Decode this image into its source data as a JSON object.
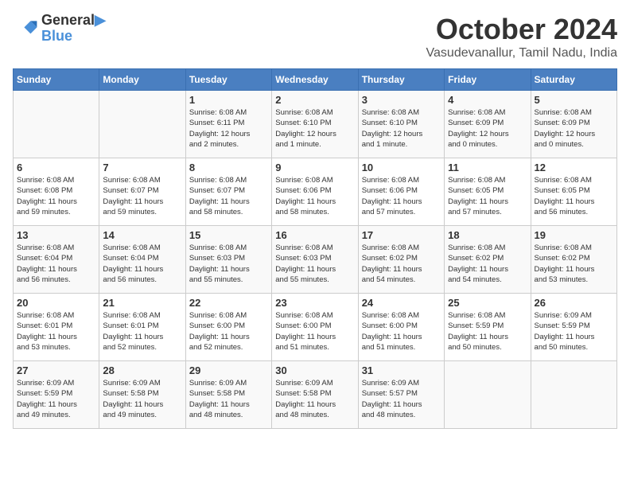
{
  "header": {
    "logo_line1": "General",
    "logo_line2": "Blue",
    "month": "October 2024",
    "location": "Vasudevanallur, Tamil Nadu, India"
  },
  "days_of_week": [
    "Sunday",
    "Monday",
    "Tuesday",
    "Wednesday",
    "Thursday",
    "Friday",
    "Saturday"
  ],
  "weeks": [
    [
      {
        "day": "",
        "info": ""
      },
      {
        "day": "",
        "info": ""
      },
      {
        "day": "1",
        "info": "Sunrise: 6:08 AM\nSunset: 6:11 PM\nDaylight: 12 hours\nand 2 minutes."
      },
      {
        "day": "2",
        "info": "Sunrise: 6:08 AM\nSunset: 6:10 PM\nDaylight: 12 hours\nand 1 minute."
      },
      {
        "day": "3",
        "info": "Sunrise: 6:08 AM\nSunset: 6:10 PM\nDaylight: 12 hours\nand 1 minute."
      },
      {
        "day": "4",
        "info": "Sunrise: 6:08 AM\nSunset: 6:09 PM\nDaylight: 12 hours\nand 0 minutes."
      },
      {
        "day": "5",
        "info": "Sunrise: 6:08 AM\nSunset: 6:09 PM\nDaylight: 12 hours\nand 0 minutes."
      }
    ],
    [
      {
        "day": "6",
        "info": "Sunrise: 6:08 AM\nSunset: 6:08 PM\nDaylight: 11 hours\nand 59 minutes."
      },
      {
        "day": "7",
        "info": "Sunrise: 6:08 AM\nSunset: 6:07 PM\nDaylight: 11 hours\nand 59 minutes."
      },
      {
        "day": "8",
        "info": "Sunrise: 6:08 AM\nSunset: 6:07 PM\nDaylight: 11 hours\nand 58 minutes."
      },
      {
        "day": "9",
        "info": "Sunrise: 6:08 AM\nSunset: 6:06 PM\nDaylight: 11 hours\nand 58 minutes."
      },
      {
        "day": "10",
        "info": "Sunrise: 6:08 AM\nSunset: 6:06 PM\nDaylight: 11 hours\nand 57 minutes."
      },
      {
        "day": "11",
        "info": "Sunrise: 6:08 AM\nSunset: 6:05 PM\nDaylight: 11 hours\nand 57 minutes."
      },
      {
        "day": "12",
        "info": "Sunrise: 6:08 AM\nSunset: 6:05 PM\nDaylight: 11 hours\nand 56 minutes."
      }
    ],
    [
      {
        "day": "13",
        "info": "Sunrise: 6:08 AM\nSunset: 6:04 PM\nDaylight: 11 hours\nand 56 minutes."
      },
      {
        "day": "14",
        "info": "Sunrise: 6:08 AM\nSunset: 6:04 PM\nDaylight: 11 hours\nand 56 minutes."
      },
      {
        "day": "15",
        "info": "Sunrise: 6:08 AM\nSunset: 6:03 PM\nDaylight: 11 hours\nand 55 minutes."
      },
      {
        "day": "16",
        "info": "Sunrise: 6:08 AM\nSunset: 6:03 PM\nDaylight: 11 hours\nand 55 minutes."
      },
      {
        "day": "17",
        "info": "Sunrise: 6:08 AM\nSunset: 6:02 PM\nDaylight: 11 hours\nand 54 minutes."
      },
      {
        "day": "18",
        "info": "Sunrise: 6:08 AM\nSunset: 6:02 PM\nDaylight: 11 hours\nand 54 minutes."
      },
      {
        "day": "19",
        "info": "Sunrise: 6:08 AM\nSunset: 6:02 PM\nDaylight: 11 hours\nand 53 minutes."
      }
    ],
    [
      {
        "day": "20",
        "info": "Sunrise: 6:08 AM\nSunset: 6:01 PM\nDaylight: 11 hours\nand 53 minutes."
      },
      {
        "day": "21",
        "info": "Sunrise: 6:08 AM\nSunset: 6:01 PM\nDaylight: 11 hours\nand 52 minutes."
      },
      {
        "day": "22",
        "info": "Sunrise: 6:08 AM\nSunset: 6:00 PM\nDaylight: 11 hours\nand 52 minutes."
      },
      {
        "day": "23",
        "info": "Sunrise: 6:08 AM\nSunset: 6:00 PM\nDaylight: 11 hours\nand 51 minutes."
      },
      {
        "day": "24",
        "info": "Sunrise: 6:08 AM\nSunset: 6:00 PM\nDaylight: 11 hours\nand 51 minutes."
      },
      {
        "day": "25",
        "info": "Sunrise: 6:08 AM\nSunset: 5:59 PM\nDaylight: 11 hours\nand 50 minutes."
      },
      {
        "day": "26",
        "info": "Sunrise: 6:09 AM\nSunset: 5:59 PM\nDaylight: 11 hours\nand 50 minutes."
      }
    ],
    [
      {
        "day": "27",
        "info": "Sunrise: 6:09 AM\nSunset: 5:59 PM\nDaylight: 11 hours\nand 49 minutes."
      },
      {
        "day": "28",
        "info": "Sunrise: 6:09 AM\nSunset: 5:58 PM\nDaylight: 11 hours\nand 49 minutes."
      },
      {
        "day": "29",
        "info": "Sunrise: 6:09 AM\nSunset: 5:58 PM\nDaylight: 11 hours\nand 48 minutes."
      },
      {
        "day": "30",
        "info": "Sunrise: 6:09 AM\nSunset: 5:58 PM\nDaylight: 11 hours\nand 48 minutes."
      },
      {
        "day": "31",
        "info": "Sunrise: 6:09 AM\nSunset: 5:57 PM\nDaylight: 11 hours\nand 48 minutes."
      },
      {
        "day": "",
        "info": ""
      },
      {
        "day": "",
        "info": ""
      }
    ]
  ]
}
